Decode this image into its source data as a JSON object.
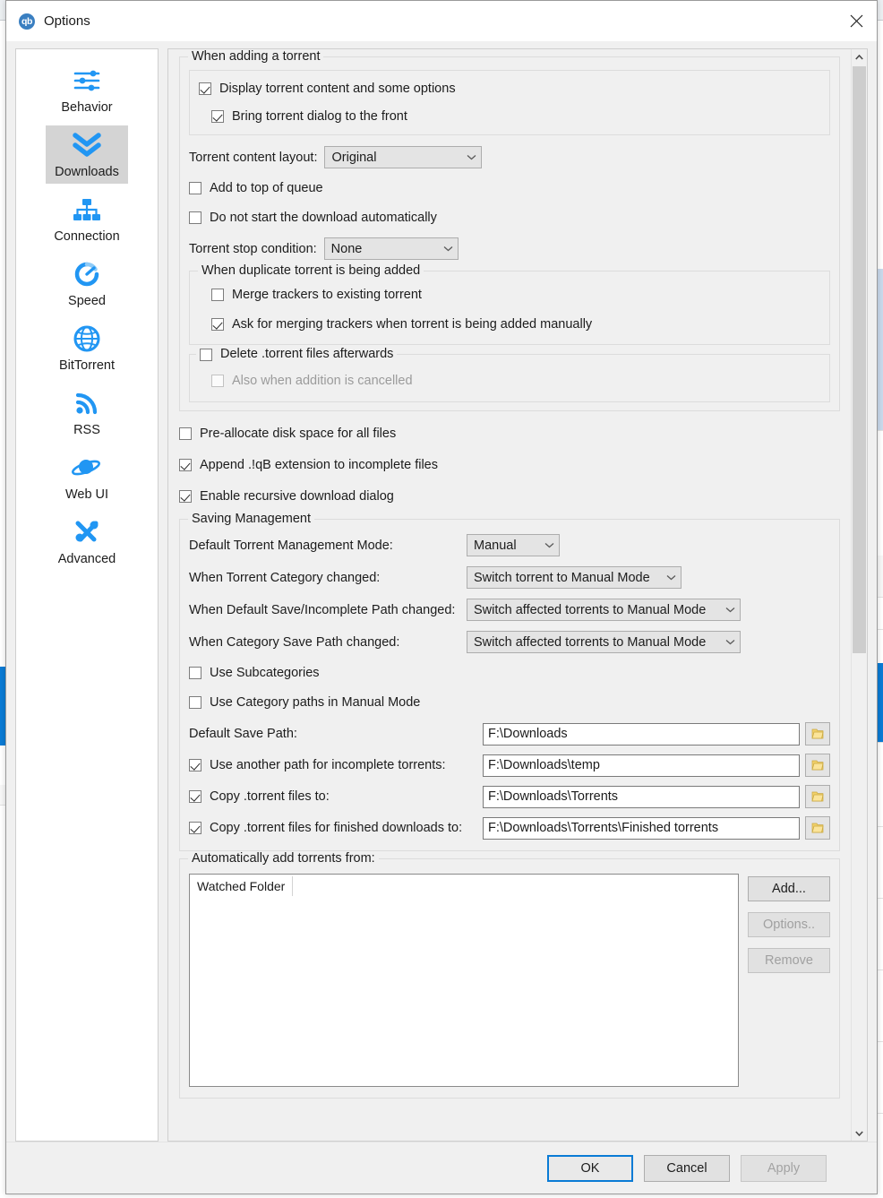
{
  "window": {
    "title": "Options",
    "logo_text": "qb",
    "close_icon": "close-icon"
  },
  "sidebar": {
    "items": [
      {
        "label": "Behavior",
        "icon": "sliders-icon",
        "selected": false
      },
      {
        "label": "Downloads",
        "icon": "download-icon",
        "selected": true
      },
      {
        "label": "Connection",
        "icon": "network-icon",
        "selected": false
      },
      {
        "label": "Speed",
        "icon": "speedometer-icon",
        "selected": false
      },
      {
        "label": "BitTorrent",
        "icon": "globe-icon",
        "selected": false
      },
      {
        "label": "RSS",
        "icon": "rss-icon",
        "selected": false
      },
      {
        "label": "Web UI",
        "icon": "planet-icon",
        "selected": false
      },
      {
        "label": "Advanced",
        "icon": "tools-icon",
        "selected": false
      }
    ]
  },
  "main": {
    "when_adding": {
      "title": "When adding a torrent",
      "display_content": {
        "label": "Display torrent content and some options",
        "checked": true
      },
      "bring_front": {
        "label": "Bring torrent dialog to the front",
        "checked": true
      },
      "content_layout_label": "Torrent content layout:",
      "content_layout_value": "Original",
      "add_top_queue": {
        "label": "Add to top of queue",
        "checked": false
      },
      "no_auto_start": {
        "label": "Do not start the download automatically",
        "checked": false
      },
      "stop_condition_label": "Torrent stop condition:",
      "stop_condition_value": "None",
      "duplicate": {
        "title": "When duplicate torrent is being added",
        "merge_trackers": {
          "label": "Merge trackers to existing torrent",
          "checked": false
        },
        "ask_merging": {
          "label": "Ask for merging trackers when torrent is being added manually",
          "checked": true
        }
      },
      "delete_afterwards": {
        "label": "Delete .torrent files afterwards",
        "checked": false
      },
      "also_cancelled": {
        "label": "Also when addition is cancelled",
        "checked": false,
        "disabled": true
      }
    },
    "preallocate": {
      "label": "Pre-allocate disk space for all files",
      "checked": false
    },
    "append_ext": {
      "label": "Append .!qB extension to incomplete files",
      "checked": true
    },
    "recursive": {
      "label": "Enable recursive download dialog",
      "checked": true
    },
    "saving": {
      "title": "Saving Management",
      "tmm_label": "Default Torrent Management Mode:",
      "tmm_value": "Manual",
      "cat_changed_label": "When Torrent Category changed:",
      "cat_changed_value": "Switch torrent to Manual Mode",
      "default_path_changed_label": "When Default Save/Incomplete Path changed:",
      "default_path_changed_value": "Switch affected torrents to Manual Mode",
      "cat_path_changed_label": "When Category Save Path changed:",
      "cat_path_changed_value": "Switch affected torrents to Manual Mode",
      "use_subcategories": {
        "label": "Use Subcategories",
        "checked": false
      },
      "use_cat_paths": {
        "label": "Use Category paths in Manual Mode",
        "checked": false
      },
      "default_save_path_label": "Default Save Path:",
      "default_save_path_value": "F:\\Downloads",
      "incomplete": {
        "label": "Use another path for incomplete torrents:",
        "checked": true,
        "value": "F:\\Downloads\\temp"
      },
      "copy_torrent": {
        "label": "Copy .torrent files to:",
        "checked": true,
        "value": "F:\\Downloads\\Torrents"
      },
      "copy_finished": {
        "label": "Copy .torrent files for finished downloads to:",
        "checked": true,
        "value": "F:\\Downloads\\Torrents\\Finished torrents"
      },
      "browse_icon": "folder-icon"
    },
    "auto_add": {
      "title": "Automatically add torrents from:",
      "column_header": "Watched Folder",
      "rows": [],
      "add_button": {
        "label": "Add...",
        "disabled": false
      },
      "options_button": {
        "label": "Options..",
        "disabled": true
      },
      "remove_button": {
        "label": "Remove",
        "disabled": true
      }
    }
  },
  "footer": {
    "ok": {
      "label": "OK",
      "disabled": false,
      "default": true
    },
    "cancel": {
      "label": "Cancel",
      "disabled": false
    },
    "apply": {
      "label": "Apply",
      "disabled": true
    }
  },
  "colors": {
    "accent": "#0a7bd5",
    "icon_blue": "#2196f3",
    "dialog_bg": "#f0f0f0",
    "folder_yellow": "#f2d16b"
  }
}
